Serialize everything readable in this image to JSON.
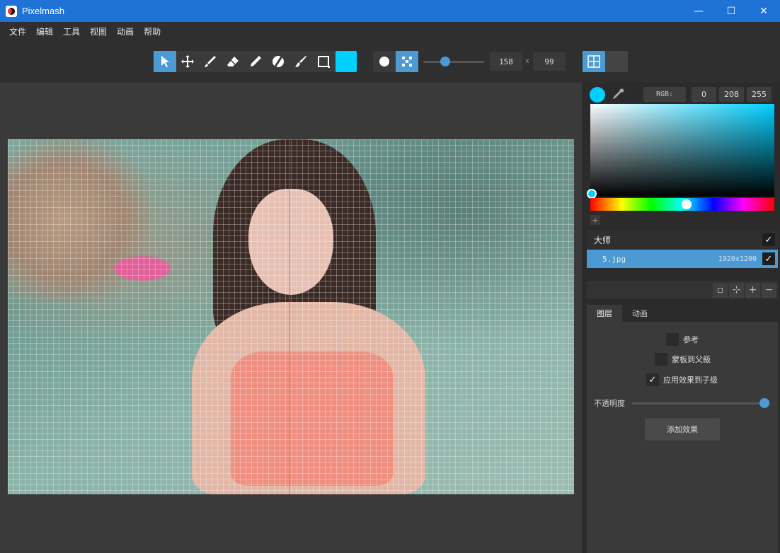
{
  "window": {
    "title": "Pixelmash",
    "minimize": "—",
    "maximize": "☐",
    "close": "✕"
  },
  "menu": [
    "文件",
    "编辑",
    "工具",
    "视图",
    "动画",
    "帮助"
  ],
  "toolbar": {
    "tools": [
      "select-arrow",
      "move",
      "brush",
      "eraser",
      "pencil",
      "fill-disc",
      "smudge-brush",
      "rectangle"
    ],
    "active_tool": "select-arrow",
    "fill_color": "#00d0ff",
    "shape_modes": [
      "circle",
      "checker"
    ],
    "brush_size": "158",
    "separator": "x",
    "canvas_value": "99",
    "accent": "#4b9ad4"
  },
  "color": {
    "current": "#00d0ff",
    "mode_label": "RGB:",
    "r": "0",
    "g": "208",
    "b": "255",
    "add": "+"
  },
  "layers": [
    {
      "name": "大师",
      "size": "",
      "checked": true
    },
    {
      "name": "5.jpg",
      "size": "1920x1200",
      "checked": true
    }
  ],
  "layer_tools": [
    "▫",
    "⊹",
    "+",
    "−"
  ],
  "tabs": [
    {
      "label": "图层",
      "active": true
    },
    {
      "label": "动画",
      "active": false
    }
  ],
  "properties": {
    "reference": "参考",
    "mask_to_parent": "蒙板到父級",
    "apply_to_children": "应用效果到子级",
    "opacity_label": "不透明度",
    "opacity": 1.0,
    "add_effect": "添加效果"
  }
}
